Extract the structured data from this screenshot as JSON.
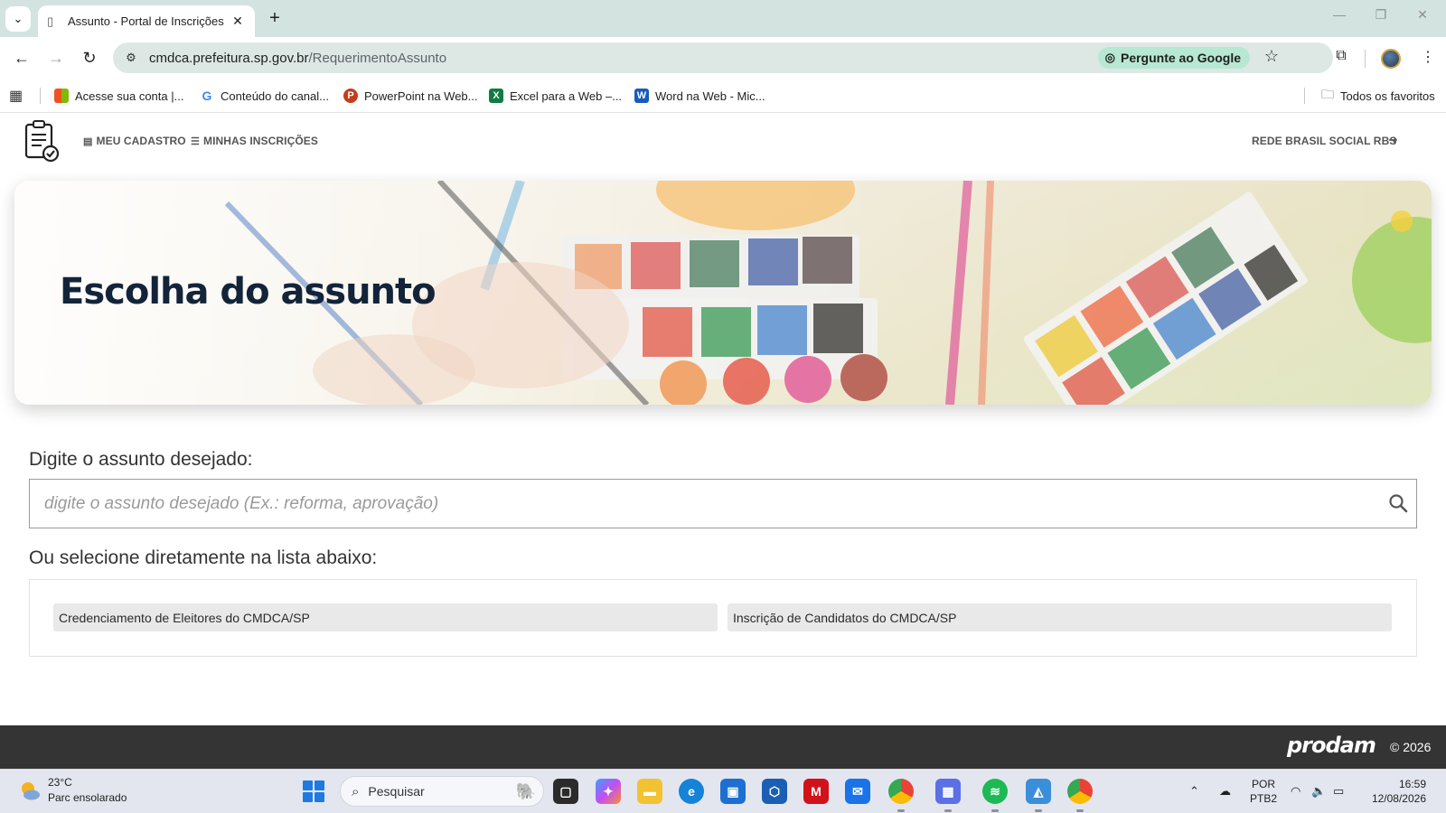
{
  "browser": {
    "tab_title": "Assunto - Portal de Inscrições",
    "url_host": "cmdca.prefeitura.sp.gov.br",
    "url_path": "/RequerimentoAssunto",
    "ask_google": "Pergunte ao Google",
    "bookmarks": [
      "Acesse sua conta |...",
      "Conteúdo do canal...",
      "PowerPoint na Web...",
      "Excel para a Web –...",
      "Word na Web - Mic..."
    ],
    "all_bookmarks": "Todos os favoritos"
  },
  "header": {
    "menu": [
      "MEU CADASTRO",
      "MINHAS INSCRIÇÕES"
    ],
    "user": "REDE BRASIL SOCIAL RBS"
  },
  "hero": {
    "title": "Escolha do assunto"
  },
  "search": {
    "label": "Digite o assunto desejado:",
    "placeholder": "digite o assunto desejado (Ex.: reforma, aprovação)",
    "value": ""
  },
  "list": {
    "label": "Ou selecione diretamente na lista abaixo:",
    "items": [
      "Credenciamento de Eleitores do CMDCA/SP",
      "Inscrição de Candidatos do CMDCA/SP"
    ]
  },
  "footer": {
    "brand": "prodam",
    "copyright": "© 2026"
  },
  "taskbar": {
    "weather_temp": "23°C",
    "weather_desc": "Parc ensolarado",
    "search_label": "Pesquisar",
    "lang_line1": "POR",
    "lang_line2": "PTB2",
    "time": "16:59",
    "date": "12/08/2026"
  },
  "colors": {
    "hero_title": "#13243a",
    "footer_bg": "#343434",
    "omnibox_bg": "#dde8e5",
    "ask_google_bg": "#b7e8d3"
  }
}
